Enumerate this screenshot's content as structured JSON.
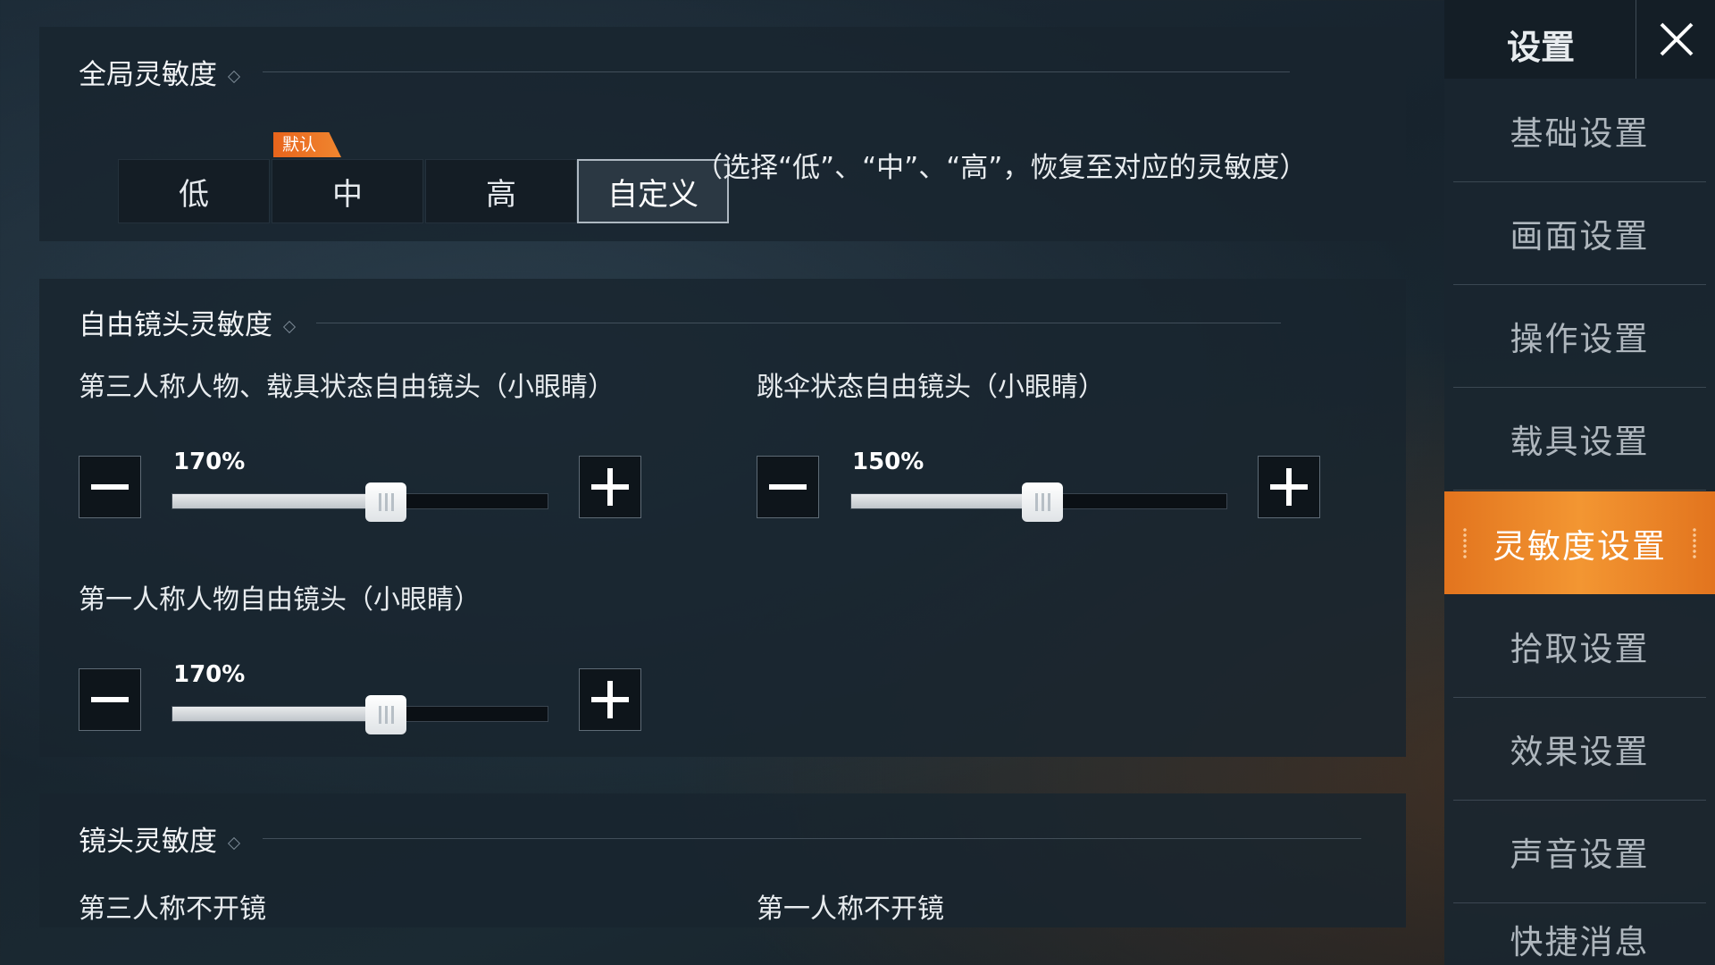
{
  "global_sensitivity": {
    "title": "全局灵敏度",
    "default_badge": "默认",
    "presets": [
      "低",
      "中",
      "高",
      "自定义"
    ],
    "selected_preset": "自定义",
    "hint": "（选择“低”、“中”、“高”，恢复至对应的灵敏度）"
  },
  "free_look": {
    "title": "自由镜头灵敏度",
    "sliders": [
      {
        "label": "第三人称人物、载具状态自由镜头（小眼睛）",
        "value_text": "170%",
        "fraction": 0.57
      },
      {
        "label": "跳伞状态自由镜头（小眼睛）",
        "value_text": "150%",
        "fraction": 0.51
      },
      {
        "label": "第一人称人物自由镜头（小眼睛）",
        "value_text": "170%",
        "fraction": 0.57
      }
    ]
  },
  "camera_sensitivity": {
    "title": "镜头灵敏度",
    "col1_label": "第三人称不开镜",
    "col2_label": "第一人称不开镜"
  },
  "sidebar": {
    "title": "设置",
    "items": [
      {
        "label": "基础设置"
      },
      {
        "label": "画面设置"
      },
      {
        "label": "操作设置"
      },
      {
        "label": "载具设置"
      },
      {
        "label": "灵敏度设置",
        "active": true
      },
      {
        "label": "拾取设置"
      },
      {
        "label": "效果设置"
      },
      {
        "label": "声音设置"
      },
      {
        "label": "快捷消息"
      }
    ]
  },
  "colors": {
    "accent": "#f0862f",
    "panel_bg": "#18242e"
  }
}
